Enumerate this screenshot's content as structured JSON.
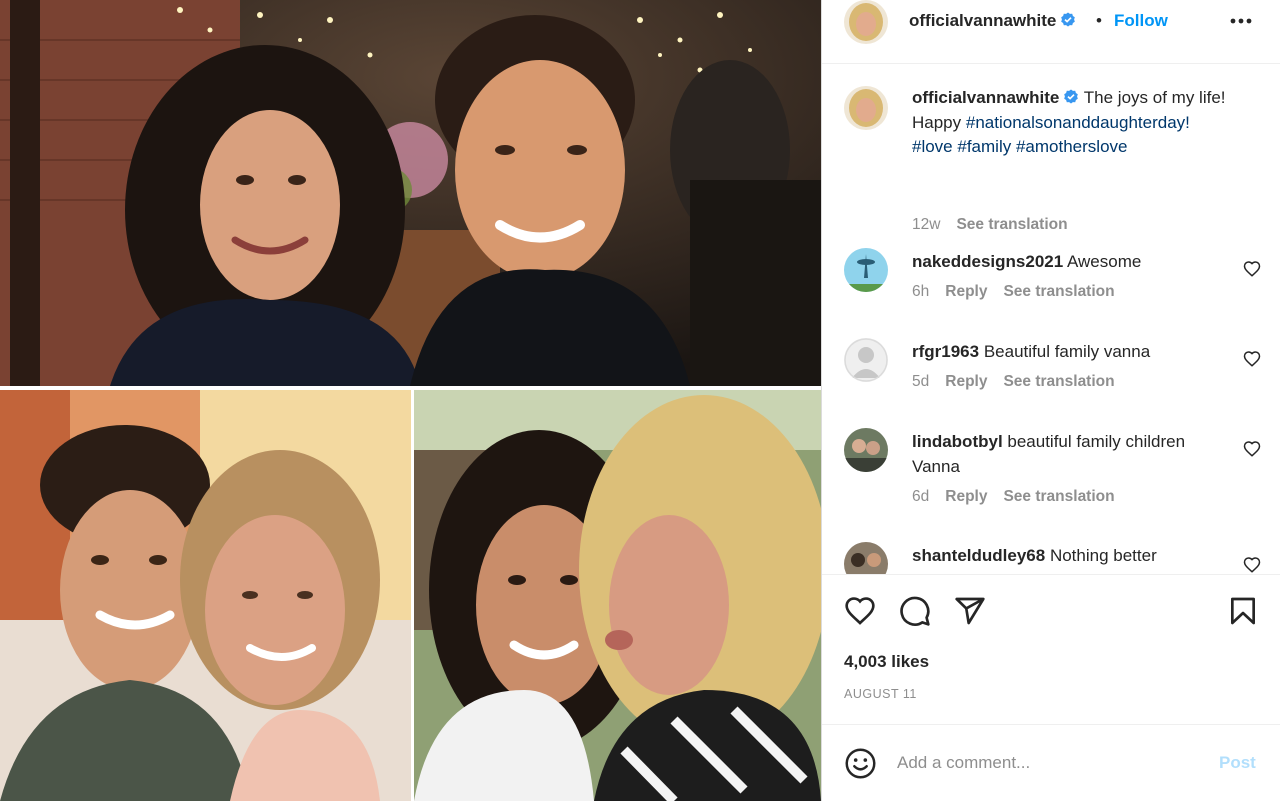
{
  "post": {
    "username": "officialvannawhite",
    "follow_label": "Follow",
    "separator": "•",
    "caption": {
      "username": "officialvannawhite",
      "text": " The joys of my life! Happy ",
      "tags": [
        "#nationalsonanddaughterday!",
        "#love",
        "#family",
        "#amotherslove"
      ],
      "time": "12w",
      "translate": "See translation"
    },
    "comments": [
      {
        "username": "nakeddesigns2021",
        "text": " Awesome",
        "time": "6h",
        "reply": "Reply",
        "translate": "See translation"
      },
      {
        "username": "rfgr1963",
        "text": " Beautiful family vanna",
        "time": "5d",
        "reply": "Reply",
        "translate": "See translation"
      },
      {
        "username": "lindabotbyl",
        "text": " beautiful family children Vanna",
        "time": "6d",
        "reply": "Reply",
        "translate": "See translation"
      },
      {
        "username": "shanteldudley68",
        "text": " Nothing better"
      }
    ],
    "likes": "4,003 likes",
    "date": "AUGUST 11",
    "comment_placeholder": "Add a comment...",
    "post_label": "Post"
  },
  "icons": {
    "header": [
      "verified-badge-icon",
      "more-options-icon"
    ],
    "actions": [
      "heart-icon",
      "comment-icon",
      "share-icon",
      "bookmark-icon"
    ],
    "comment": [
      "emoji-icon",
      "comment-like-icon"
    ]
  },
  "colors": {
    "link": "#0095f6",
    "hashtag": "#00376b",
    "muted": "#8e8e8e",
    "post_disabled": "#b2dffc"
  }
}
